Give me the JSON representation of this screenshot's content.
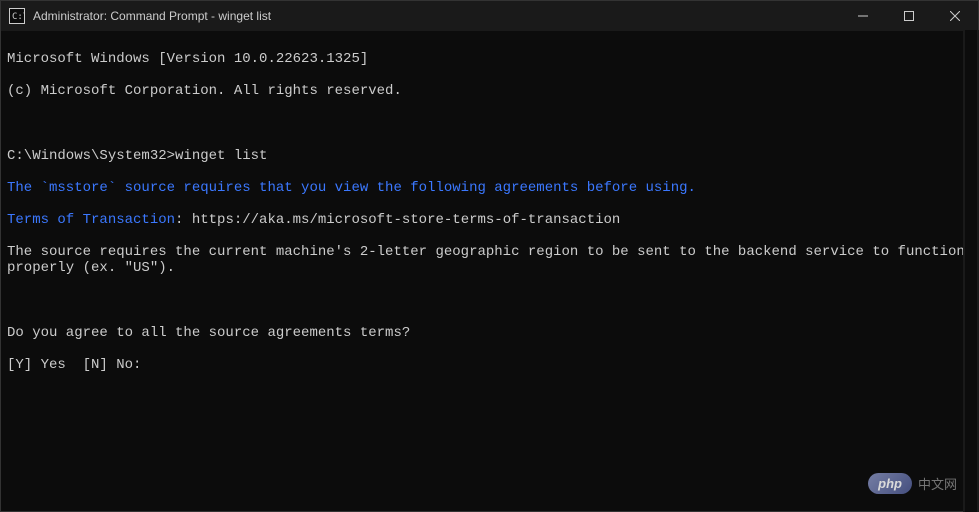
{
  "titlebar": {
    "title": "Administrator: Command Prompt - winget  list"
  },
  "terminal": {
    "line1": "Microsoft Windows [Version 10.0.22623.1325]",
    "line2": "(c) Microsoft Corporation. All rights reserved.",
    "prompt": "C:\\Windows\\System32>",
    "command": "winget list",
    "msg1": "The `msstore` source requires that you view the following agreements before using.",
    "terms_label": "Terms of Transaction",
    "terms_sep": ": ",
    "terms_url": "https://aka.ms/microsoft-store-terms-of-transaction",
    "msg2": "The source requires the current machine's 2-letter geographic region to be sent to the backend service to function properly (ex. \"US\").",
    "question": "Do you agree to all the source agreements terms?",
    "options": "[Y] Yes  [N] No: "
  },
  "watermark": {
    "logo": "php",
    "text": "中文网"
  }
}
